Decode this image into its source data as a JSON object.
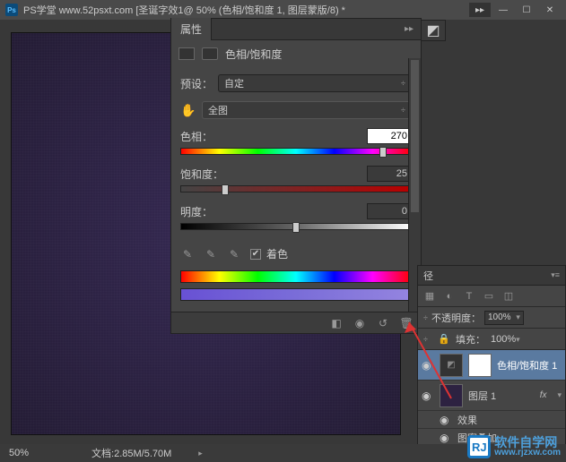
{
  "titlebar": {
    "ps": "Ps",
    "title": "PS学堂  www.52psxt.com [圣诞字效1@ 50% (色相/饱和度 1, 图层蒙版/8) *"
  },
  "properties": {
    "tab": "属性",
    "header": "色相/饱和度",
    "preset_label": "预设：",
    "preset_value": "自定",
    "channel_value": "全图",
    "hue_label": "色相：",
    "hue_value": "270",
    "sat_label": "饱和度：",
    "sat_value": "25",
    "light_label": "明度：",
    "light_value": "0",
    "colorize": "着色",
    "checkmark": "✔"
  },
  "layers": {
    "tab": "径",
    "opacity_label": "不透明度：",
    "opacity_value": "100%",
    "lock_label": "锁定：",
    "fill_label": "填充：",
    "fill_value": "100%",
    "layer1_name": "色相/饱和度 1",
    "layer2_name": "图层 1",
    "fx": "fx",
    "effects": "效果",
    "pattern_overlay": "图案叠加"
  },
  "statusbar": {
    "zoom": "50%",
    "docinfo": "文档:2.85M/5.70M"
  },
  "watermark": {
    "logo": "RJ",
    "text": "软件自学网",
    "url": "www.rjzxw.com"
  },
  "glyph": {
    "eye": "◉",
    "chevdown": "▾",
    "chevright": "▸",
    "flyout": "▸▸",
    "hand": "✋",
    "eyedrop": "✎",
    "reset": "↺",
    "trash": "🗑",
    "clip": "◧",
    "view": "◉",
    "lock": "🔒",
    "plus": "✚",
    "T": "T",
    "dropdown_arrow": "÷"
  }
}
